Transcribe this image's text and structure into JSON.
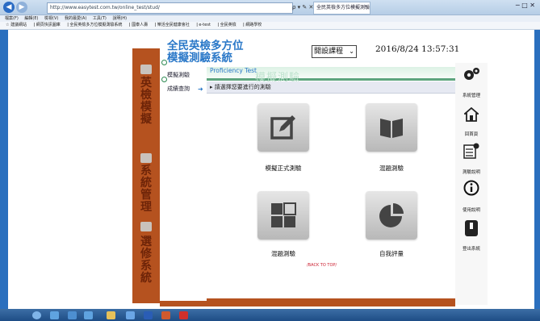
{
  "browser": {
    "address": "http://www.easytest.com.tw/online_test/stud/",
    "address_controls": "ρ ▾ ✎ ✕",
    "tab_title": "全民英檢多方位模擬測驗系統",
    "window_controls": "─ □ ✕",
    "menu": [
      "檔案(F)",
      "編輯(E)",
      "檢視(V)",
      "我的最愛(A)",
      "工具(T)",
      "說明(H)"
    ],
    "favorites": [
      "☆ 建議網站",
      "ǀ 網頁快訊圖庫",
      "ǀ 全民英檢多方位模擬測驗系統",
      "ǀ 國泰人壽",
      "ǀ 樂活全民健康會社",
      "ǀ e-test",
      "ǀ 全民英檢",
      "ǀ 網路學校"
    ]
  },
  "system": {
    "title_line1": "全民英檢多方位",
    "title_line2": "模擬測驗系統"
  },
  "header": {
    "course_select": "開設課程",
    "datetime": "2016/8/24 13:57:31"
  },
  "rail": {
    "item1": [
      "英",
      "檢",
      "模",
      "擬"
    ],
    "item2": [
      "系",
      "統",
      "管",
      "理"
    ],
    "item3": [
      "選",
      "修",
      "系",
      "統"
    ]
  },
  "left_nav": {
    "item1": "模擬測驗",
    "item2": "成績查詢",
    "arrow": "➜"
  },
  "section": {
    "title_en": "Proficiency Test",
    "title_zh": "模擬測驗"
  },
  "instruction": "▸ 請選擇您要進行的測驗",
  "cards": {
    "formal": "模擬正式測驗",
    "mixed": "混題測驗",
    "random": "混題測驗",
    "self": "自我評量"
  },
  "back_to_top": "/BACK TO TOP/",
  "right_rail": {
    "system_manage": "系統管理",
    "home": "回首頁",
    "test_intro": "測驗說明",
    "user_guide": "使用說明",
    "logout": "登出系統"
  },
  "colors": {
    "rail_orange": "#b5521f",
    "title_blue": "#2a78c8",
    "band_green": "#5da57e",
    "desktop_blue": "#1f6fb6"
  }
}
